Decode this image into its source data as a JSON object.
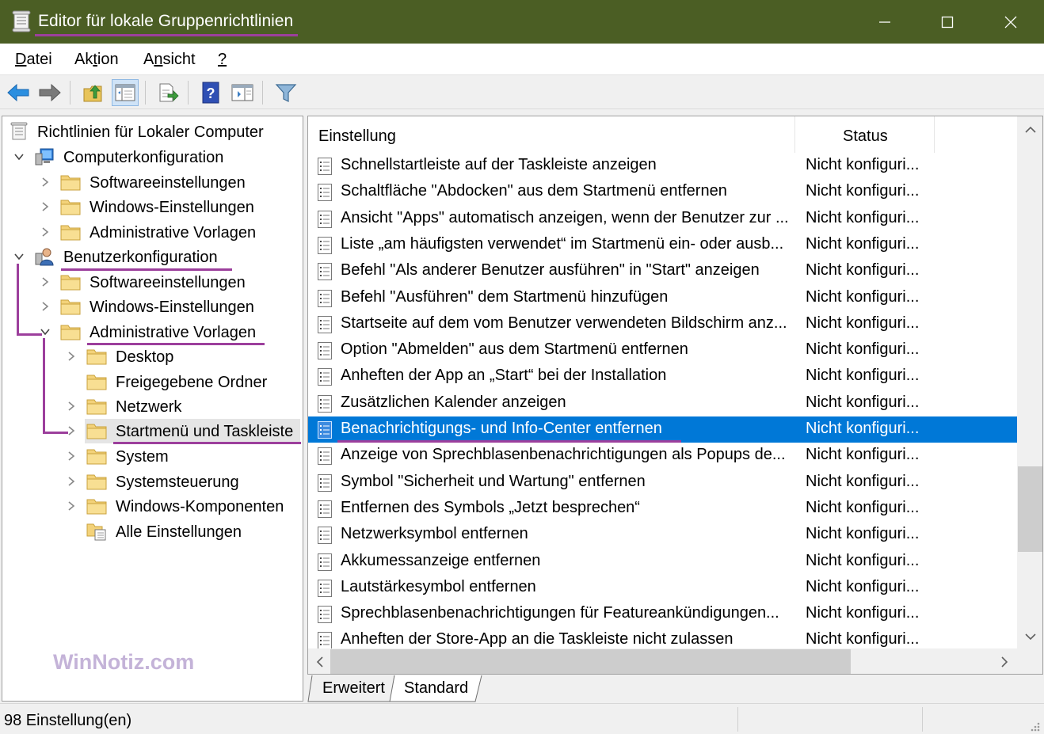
{
  "window": {
    "title": "Editor für lokale Gruppenrichtlinien"
  },
  "menu": {
    "items": [
      {
        "label": "Datei"
      },
      {
        "label": "Aktion"
      },
      {
        "label": "Ansicht"
      },
      {
        "label": "?"
      }
    ]
  },
  "toolbar": {
    "icons": [
      "back-arrow-icon",
      "forward-arrow-icon",
      "up-folder-icon",
      "show-hide-tree-icon",
      "export-list-icon",
      "help-icon",
      "properties-icon",
      "filter-icon"
    ]
  },
  "tree": {
    "root": "Richtlinien für Lokaler Computer",
    "computer": {
      "label": "Computerkonfiguration",
      "children": [
        "Softwareeinstellungen",
        "Windows-Einstellungen",
        "Administrative Vorlagen"
      ]
    },
    "user": {
      "label": "Benutzerkonfiguration",
      "children": [
        "Softwareeinstellungen",
        "Windows-Einstellungen",
        "Administrative Vorlagen"
      ]
    },
    "admin_templates_children": [
      "Desktop",
      "Freigegebene Ordner",
      "Netzwerk",
      "Startmenü und Taskleiste",
      "System",
      "Systemsteuerung",
      "Windows-Komponenten",
      "Alle Einstellungen"
    ],
    "selected": "Startmenü und Taskleiste"
  },
  "watermark": "WinNotiz.com",
  "list": {
    "columns": {
      "setting": "Einstellung",
      "status": "Status"
    },
    "rows": [
      {
        "name": "Schnellstartleiste auf der Taskleiste anzeigen",
        "status": "Nicht konfiguri..."
      },
      {
        "name": "Schaltfläche \"Abdocken\" aus dem Startmenü entfernen",
        "status": "Nicht konfiguri..."
      },
      {
        "name": "Ansicht \"Apps\" automatisch anzeigen, wenn der Benutzer zur ...",
        "status": "Nicht konfiguri..."
      },
      {
        "name": "Liste „am häufigsten verwendet“ im Startmenü ein- oder ausb...",
        "status": "Nicht konfiguri..."
      },
      {
        "name": "Befehl \"Als anderer Benutzer ausführen\" in \"Start\" anzeigen",
        "status": "Nicht konfiguri..."
      },
      {
        "name": "Befehl \"Ausführen\" dem Startmenü hinzufügen",
        "status": "Nicht konfiguri..."
      },
      {
        "name": "Startseite auf dem vom Benutzer verwendeten Bildschirm anz...",
        "status": "Nicht konfiguri..."
      },
      {
        "name": "Option \"Abmelden\" aus dem Startmenü entfernen",
        "status": "Nicht konfiguri..."
      },
      {
        "name": "Anheften der App an „Start“ bei der Installation",
        "status": "Nicht konfiguri..."
      },
      {
        "name": "Zusätzlichen Kalender anzeigen",
        "status": "Nicht konfiguri..."
      },
      {
        "name": "Benachrichtigungs- und Info-Center entfernen",
        "status": "Nicht konfiguri..."
      },
      {
        "name": "Anzeige von Sprechblasenbenachrichtigungen als Popups de...",
        "status": "Nicht konfiguri..."
      },
      {
        "name": "Symbol \"Sicherheit und Wartung\" entfernen",
        "status": "Nicht konfiguri..."
      },
      {
        "name": "Entfernen des Symbols „Jetzt besprechen“",
        "status": "Nicht konfiguri..."
      },
      {
        "name": "Netzwerksymbol entfernen",
        "status": "Nicht konfiguri..."
      },
      {
        "name": "Akkumessanzeige entfernen",
        "status": "Nicht konfiguri..."
      },
      {
        "name": "Lautstärkesymbol entfernen",
        "status": "Nicht konfiguri..."
      },
      {
        "name": "Sprechblasenbenachrichtigungen für Featureankündigungen...",
        "status": "Nicht konfiguri..."
      },
      {
        "name": "Anheften der Store-App an die Taskleiste nicht zulassen",
        "status": "Nicht konfiguri..."
      }
    ],
    "selected_index": 10
  },
  "tabs": [
    {
      "label": "Erweitert"
    },
    {
      "label": "Standard"
    }
  ],
  "statusbar": {
    "text": "98 Einstellung(en)"
  },
  "colors": {
    "titlebar": "#4b5e24",
    "selection": "#0078d7",
    "annotation": "#9c3f9c"
  }
}
